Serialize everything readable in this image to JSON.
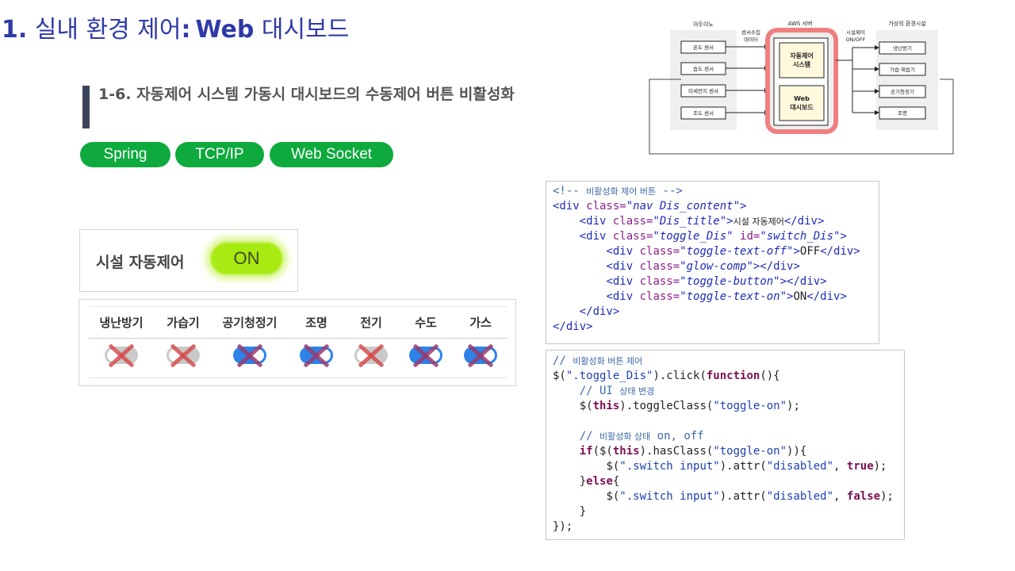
{
  "title": {
    "number": "1.",
    "text": "실내 환경 제어",
    "colon": ":",
    "web": "Web",
    "rest": "대시보드"
  },
  "subtitle": "1-6. 자동제어 시스템 가동시 대시보드의 수동제어 버튼 비활성화",
  "tags": [
    "Spring",
    "TCP/IP",
    "Web Socket"
  ],
  "toggle_panel": {
    "label": "시설 자동제어",
    "state": "ON"
  },
  "devices": [
    {
      "name": "냉난방기",
      "state": "off"
    },
    {
      "name": "가습기",
      "state": "off"
    },
    {
      "name": "공기청정기",
      "state": "on"
    },
    {
      "name": "조명",
      "state": "on"
    },
    {
      "name": "전기",
      "state": "off"
    },
    {
      "name": "수도",
      "state": "on"
    },
    {
      "name": "가스",
      "state": "on"
    }
  ],
  "diagram": {
    "arduino_header": "아두이노",
    "aws_header": "AWS 서버",
    "virtual_header": "가상의 환경시설",
    "sensor_collect": [
      "센서수집",
      "데이터"
    ],
    "facility_control": [
      "시설제어",
      "ON/OFF"
    ],
    "sensors": [
      "온도 센서",
      "습도 센서",
      "미세먼지 센서",
      "조도 센서"
    ],
    "auto_system": [
      "자동제어",
      "시스템"
    ],
    "web_dashboard": [
      "Web",
      "대시보드"
    ],
    "facilities": [
      "냉난방기",
      "가습·제습기",
      "공기청정기",
      "조명"
    ],
    "colors": {
      "aws_border": "#f08080",
      "box_fill": "#fff8dc"
    }
  },
  "code_html": {
    "l1": "<!-- ",
    "l1k": "비활성화 제어 버튼",
    "l1e": " -->",
    "div": "<div",
    "close": ">",
    "end_div": "</div>",
    "class": " class=",
    "id": " id=",
    "v_nav": "\"nav Dis_content\"",
    "v_title": "\"Dis_title\"",
    "t_title": "시설 자동제어",
    "v_toggle": "\"toggle_Dis\"",
    "v_switch": "\"switch_Dis\"",
    "v_off": "\"toggle-text-off\"",
    "t_off": "OFF",
    "v_glow": "\"glow-comp\"",
    "v_button": "\"toggle-button\"",
    "v_on": "\"toggle-text-on\"",
    "t_on": "ON"
  },
  "code_js": {
    "c1a": "// ",
    "c1b": "비활성화 버튼 제어",
    "l2a": "$(",
    "l2b": "\".toggle_Dis\"",
    "l2c": ").click(",
    "l2d": "function",
    "l2e": "(){",
    "c2a": "// UI ",
    "c2b": "상태 변경",
    "l3a": "$(",
    "l3b": "this",
    "l3c": ").toggleClass(",
    "l3d": "\"toggle-on\"",
    "l3e": ");",
    "c3a": "// ",
    "c3b": "비활성화 상태",
    "c3c": " on, off",
    "l4a": "if",
    "l4b": "($(",
    "l4c": "this",
    "l4d": ").hasClass(",
    "l4e": "\"toggle-on\"",
    "l4f": ")){",
    "l5a": "$(",
    "l5b": "\".switch input\"",
    "l5c": ").attr(",
    "l5d": "\"disabled\"",
    "l5e": ", ",
    "l5f": "true",
    "l5g": ");",
    "l6a": "}",
    "l6b": "else",
    "l6c": "{",
    "l7a": "$(",
    "l7b": "\".switch input\"",
    "l7c": ").attr(",
    "l7d": "\"disabled\"",
    "l7e": ", ",
    "l7f": "false",
    "l7g": ");",
    "l8": "}",
    "l9": "});"
  }
}
